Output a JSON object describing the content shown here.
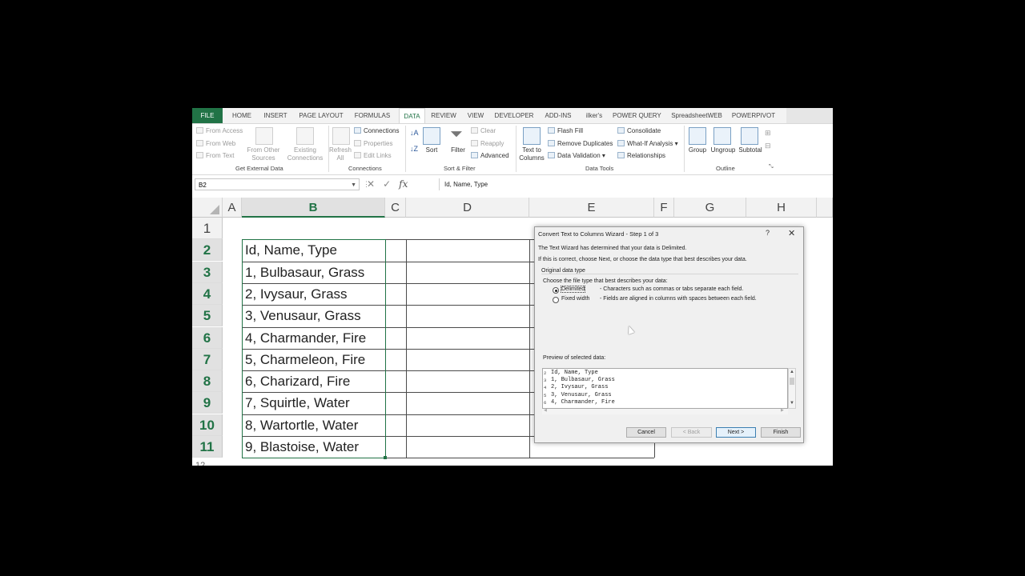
{
  "ribbon": {
    "tabs": [
      "FILE",
      "HOME",
      "INSERT",
      "PAGE LAYOUT",
      "FORMULAS",
      "DATA",
      "REVIEW",
      "VIEW",
      "DEVELOPER",
      "ADD-INS",
      "ilker's",
      "POWER QUERY",
      "SpreadsheetWEB",
      "POWERPIVOT"
    ],
    "active_tab": "DATA",
    "get_external": {
      "from_access": "From Access",
      "from_web": "From Web",
      "from_text": "From Text",
      "from_other": "From Other",
      "from_other2": "Sources",
      "existing": "Existing",
      "existing2": "Connections",
      "label": "Get External Data"
    },
    "connections": {
      "refresh": "Refresh",
      "refresh2": "All",
      "connections": "Connections",
      "properties": "Properties",
      "edit_links": "Edit Links",
      "label": "Connections"
    },
    "sort_filter": {
      "sort": "Sort",
      "filter": "Filter",
      "clear": "Clear",
      "reapply": "Reapply",
      "advanced": "Advanced",
      "label": "Sort & Filter"
    },
    "data_tools": {
      "text_to": "Text to",
      "columns": "Columns",
      "flash_fill": "Flash Fill",
      "remove_dup": "Remove Duplicates",
      "validation": "Data Validation",
      "consolidate": "Consolidate",
      "whatif": "What-If Analysis",
      "relationships": "Relationships",
      "label": "Data Tools"
    },
    "outline": {
      "group": "Group",
      "ungroup": "Ungroup",
      "subtotal": "Subtotal",
      "label": "Outline"
    }
  },
  "formula_bar": {
    "name_box": "B2",
    "formula": "Id, Name, Type"
  },
  "grid": {
    "columns": [
      "A",
      "B",
      "C",
      "D",
      "E",
      "F",
      "G",
      "H"
    ],
    "selected_column": "B",
    "rows": [
      "1",
      "2",
      "3",
      "4",
      "5",
      "6",
      "7",
      "8",
      "9",
      "10",
      "11"
    ],
    "selected_rows": [
      "2",
      "3",
      "4",
      "5",
      "6",
      "7",
      "8",
      "9",
      "10",
      "11"
    ],
    "b_values": [
      "",
      "Id, Name, Type",
      "1, Bulbasaur, Grass",
      "2, Ivysaur, Grass",
      "3, Venusaur, Grass",
      "4, Charmander, Fire",
      "5, Charmeleon, Fire",
      "6, Charizard, Fire",
      "7, Squirtle, Water",
      "8, Wartortle, Water",
      "9, Blastoise, Water"
    ]
  },
  "dialog": {
    "title": "Convert Text to Columns Wizard - Step 1 of 3",
    "help": "?",
    "close": "✕",
    "line1": "The Text Wizard has determined that your data is Delimited.",
    "line2": "If this is correct, choose Next, or choose the data type that best describes your data.",
    "group_label": "Original data type",
    "choose_label": "Choose the file type that best describes your data:",
    "delimited": "Delimited",
    "delimited_desc": "- Characters such as commas or tabs separate each field.",
    "fixed": "Fixed width",
    "fixed_desc": "- Fields are aligned in columns with spaces between each field.",
    "selected_option": "Delimited",
    "preview_label": "Preview of selected data:",
    "preview_lines": [
      "Id, Name, Type",
      "1, Bulbasaur, Grass",
      "2, Ivysaur, Grass",
      "3, Venusaur, Grass",
      "4, Charmander, Fire"
    ],
    "preview_nums": [
      "2",
      "3",
      "4",
      "5",
      "6"
    ],
    "buttons": {
      "cancel": "Cancel",
      "back": "< Back",
      "next": "Next >",
      "finish": "Finish"
    }
  }
}
